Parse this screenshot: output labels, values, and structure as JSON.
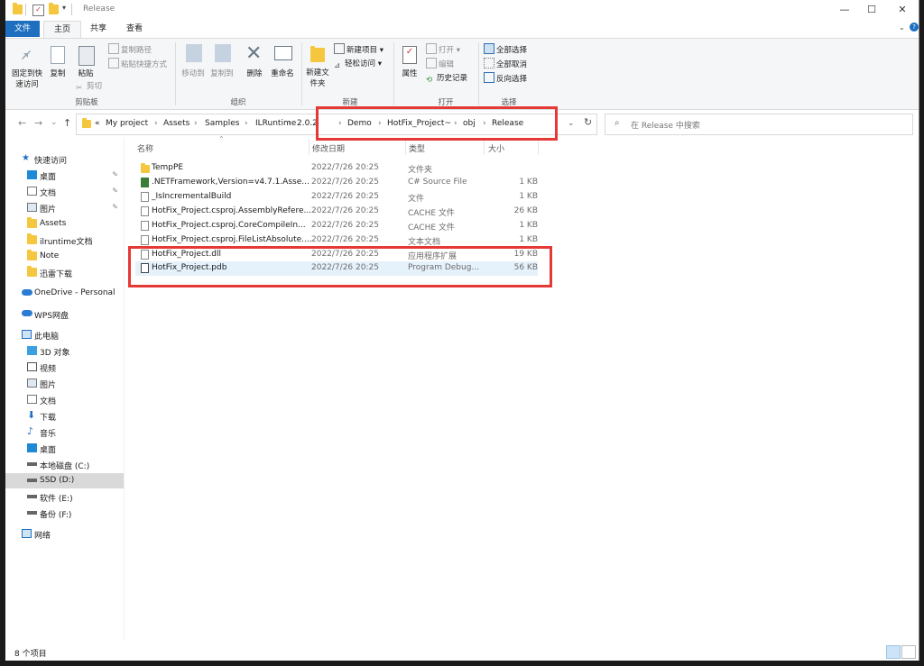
{
  "window": {
    "title": "Release",
    "controls": {
      "minimize": "—",
      "maximize": "☐",
      "close": "✕"
    },
    "help": "?"
  },
  "ribbon_tabs": [
    "文件",
    "主页",
    "共享",
    "查看"
  ],
  "ribbon": {
    "clipboard": {
      "pin_quick_access": "固定到快速访问",
      "copy": "复制",
      "paste": "粘贴",
      "copy_path": "复制路径",
      "paste_shortcut": "粘贴快捷方式",
      "cut": "剪切",
      "group_label": "剪贴板"
    },
    "organize": {
      "move_to": "移动到",
      "copy_to": "复制到",
      "delete": "删除",
      "rename": "重命名",
      "group_label": "组织"
    },
    "new": {
      "new_folder": "新建文件夹",
      "new_item": "新建项目",
      "easy_access": "轻松访问",
      "group_label": "新建"
    },
    "open": {
      "properties": "属性",
      "open": "打开",
      "edit": "编辑",
      "history": "历史记录",
      "group_label": "打开"
    },
    "select": {
      "select_all": "全部选择",
      "select_none": "全部取消",
      "invert": "反向选择",
      "group_label": "选择"
    }
  },
  "navigation": {
    "back": "←",
    "forward": "→",
    "recent": "⌄",
    "up": "↑",
    "refresh": "↻",
    "breadcrumb": [
      "«",
      "My project",
      "Assets",
      "Samples",
      "ILRuntime",
      "2.0.2",
      "Demo",
      "HotFix_Project~",
      "obj",
      "Release"
    ],
    "search_placeholder": "在 Release 中搜索"
  },
  "sidebar": {
    "quick_access": "快速访问",
    "quick_items": [
      "桌面",
      "文档",
      "图片",
      "Assets",
      "ilruntime文档",
      "Note",
      "迅雷下载"
    ],
    "onedrive": "OneDrive - Personal",
    "wps": "WPS网盘",
    "this_pc": "此电脑",
    "pc_items": [
      "3D 对象",
      "视频",
      "图片",
      "文档",
      "下载",
      "音乐",
      "桌面",
      "本地磁盘 (C:)",
      "SSD (D:)",
      "软件 (E:)",
      "备份 (F:)"
    ],
    "network": "网络"
  },
  "columns": {
    "name": "名称",
    "modified": "修改日期",
    "type": "类型",
    "size": "大小"
  },
  "files": [
    {
      "name": "TempPE",
      "modified": "2022/7/26 20:25",
      "type": "文件夹",
      "size": "",
      "kind": "folder"
    },
    {
      "name": ".NETFramework,Version=v4.7.1.Asse...",
      "modified": "2022/7/26 20:25",
      "type": "C# Source File",
      "size": "1 KB",
      "kind": "cs"
    },
    {
      "name": "_IsIncrementalBuild",
      "modified": "2022/7/26 20:25",
      "type": "文件",
      "size": "1 KB",
      "kind": "file"
    },
    {
      "name": "HotFix_Project.csproj.AssemblyRefere...",
      "modified": "2022/7/26 20:25",
      "type": "CACHE 文件",
      "size": "26 KB",
      "kind": "file"
    },
    {
      "name": "HotFix_Project.csproj.CoreCompileIn...",
      "modified": "2022/7/26 20:25",
      "type": "CACHE 文件",
      "size": "1 KB",
      "kind": "file"
    },
    {
      "name": "HotFix_Project.csproj.FileListAbsolute....",
      "modified": "2022/7/26 20:25",
      "type": "文本文档",
      "size": "1 KB",
      "kind": "file"
    },
    {
      "name": "HotFix_Project.dll",
      "modified": "2022/7/26 20:25",
      "type": "应用程序扩展",
      "size": "19 KB",
      "kind": "dll"
    },
    {
      "name": "HotFix_Project.pdb",
      "modified": "2022/7/26 20:25",
      "type": "Program Debug...",
      "size": "56 KB",
      "kind": "pdb"
    }
  ],
  "status": {
    "item_count": "8 个项目"
  },
  "colors": {
    "accent": "#1e6fc0",
    "highlight_box": "#e53935",
    "folder": "#f5c73e",
    "selected_row": "#e5f1fb"
  }
}
